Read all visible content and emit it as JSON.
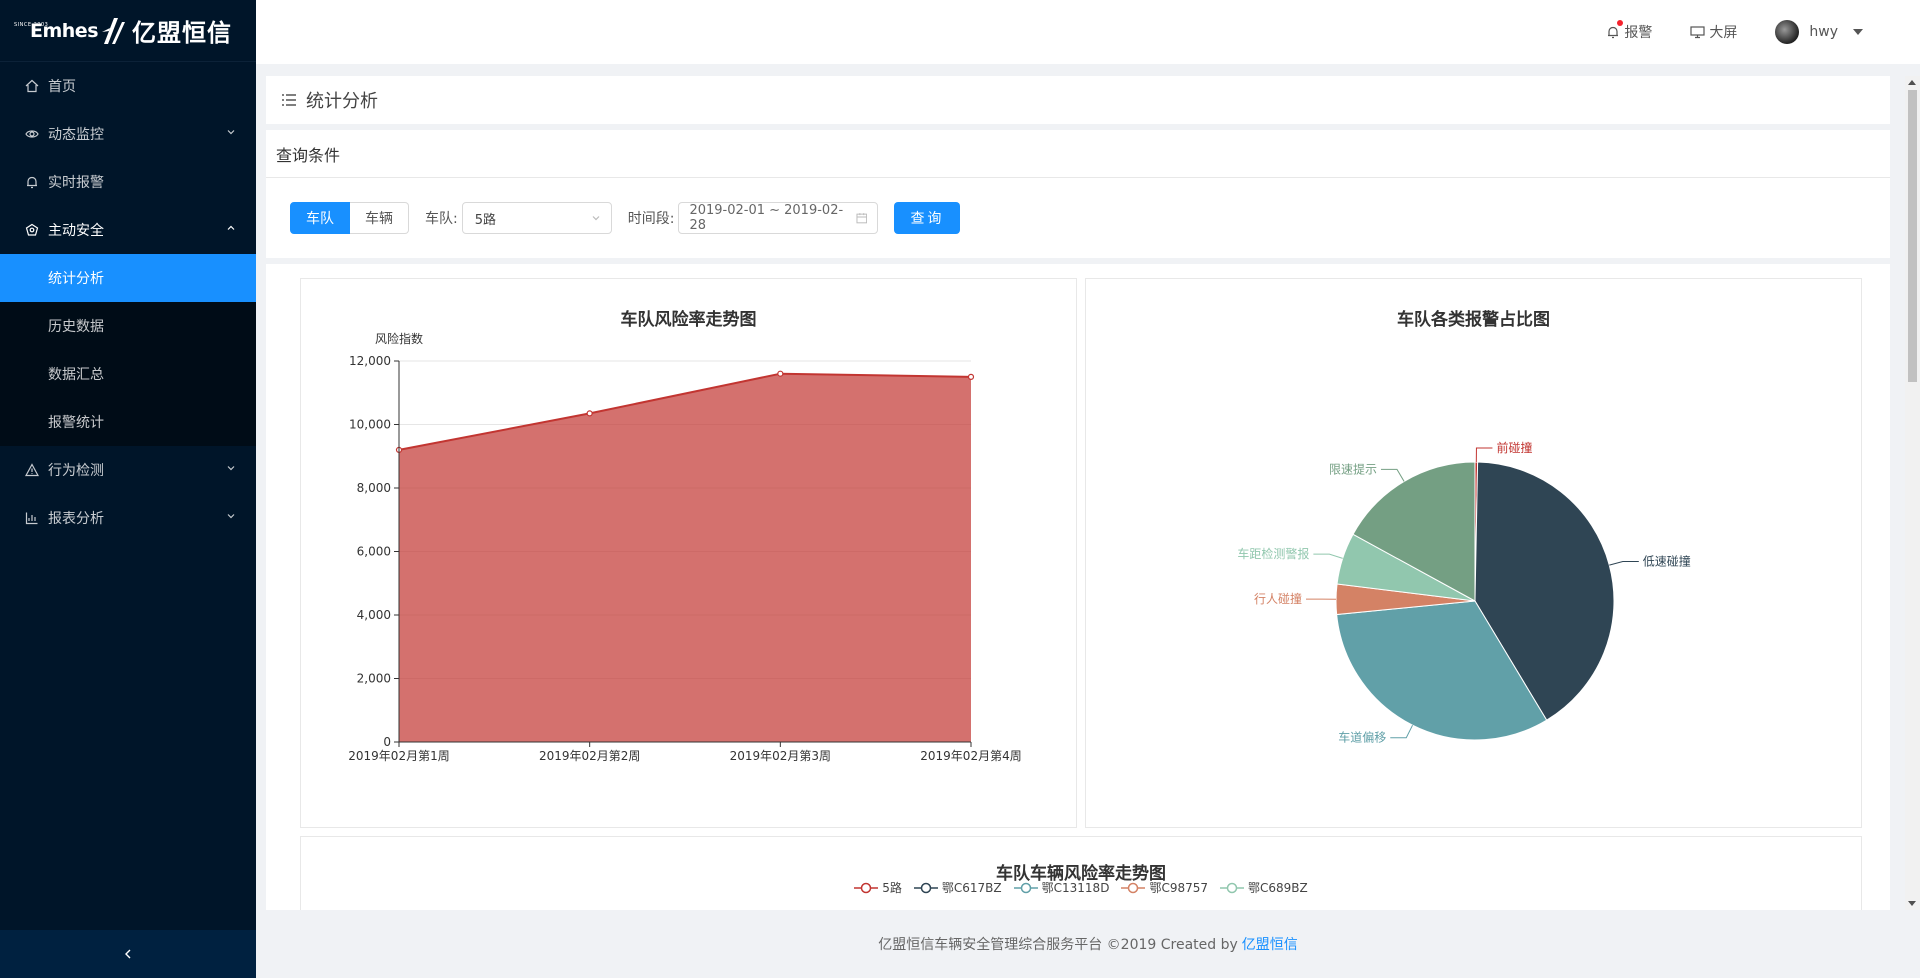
{
  "brand": {
    "en": "Emhes",
    "since": "SINCE 2003",
    "cn": "亿盟恒信"
  },
  "header": {
    "alarm": "报警",
    "bigscreen": "大屏",
    "user": "hwy"
  },
  "sidebar": {
    "items": [
      {
        "label": "首页"
      },
      {
        "label": "动态监控"
      },
      {
        "label": "实时报警"
      },
      {
        "label": "主动安全"
      },
      {
        "label": "行为检测"
      },
      {
        "label": "报表分析"
      }
    ],
    "sub": [
      {
        "label": "统计分析"
      },
      {
        "label": "历史数据"
      },
      {
        "label": "数据汇总"
      },
      {
        "label": "报警统计"
      }
    ]
  },
  "page": {
    "title": "统计分析"
  },
  "query": {
    "title": "查询条件",
    "seg_fleet": "车队",
    "seg_vehicle": "车辆",
    "fleet_label": "车队:",
    "fleet_value": "5路",
    "time_label": "时间段:",
    "time_value": "2019-02-01 ~ 2019-02-28",
    "search": "查询"
  },
  "chart_data": [
    {
      "type": "area",
      "title": "车队风险率走势图",
      "ylabel": "风险指数",
      "categories": [
        "2019年02月第1周",
        "2019年02月第2周",
        "2019年02月第3周",
        "2019年02月第4周"
      ],
      "values": [
        9200,
        10350,
        11600,
        11500
      ],
      "ylim": [
        0,
        12000
      ],
      "yticks": [
        "0",
        "2,000",
        "4,000",
        "6,000",
        "8,000",
        "10,000",
        "12,000"
      ],
      "color": "#c23531"
    },
    {
      "type": "pie",
      "title": "车队各类报警占比图",
      "slices": [
        {
          "name": "前碰撞",
          "value": 0.3,
          "color": "#c23531"
        },
        {
          "name": "低速碰撞",
          "value": 41,
          "color": "#2f4554"
        },
        {
          "name": "车道偏移",
          "value": 32,
          "color": "#61a0a8"
        },
        {
          "name": "行人碰撞",
          "value": 3.5,
          "color": "#d48265"
        },
        {
          "name": "车距检测警报",
          "value": 6,
          "color": "#91c7ae"
        },
        {
          "name": "限速提示",
          "value": 17,
          "color": "#749f83"
        }
      ]
    },
    {
      "type": "line",
      "title": "车队车辆风险率走势图",
      "series": [
        {
          "name": "5路",
          "color": "#c23531"
        },
        {
          "name": "鄂C617BZ",
          "color": "#2f4554"
        },
        {
          "name": "鄂C13118D",
          "color": "#61a0a8"
        },
        {
          "name": "鄂C98757",
          "color": "#d48265"
        },
        {
          "name": "鄂C689BZ",
          "color": "#91c7ae"
        }
      ]
    }
  ],
  "footer": {
    "text": "亿盟恒信车辆安全管理综合服务平台 ©2019 Created by",
    "link": "亿盟恒信"
  }
}
